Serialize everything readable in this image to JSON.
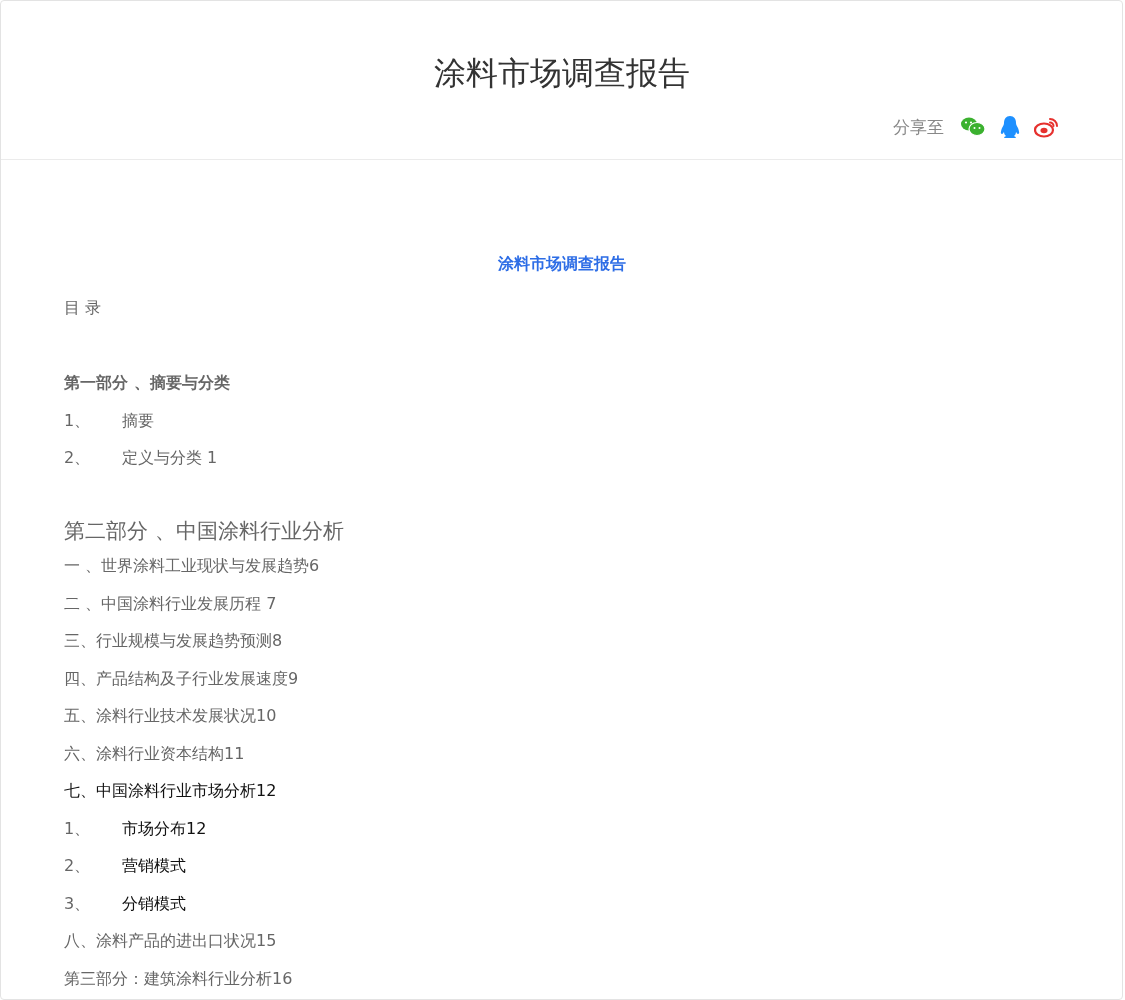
{
  "article": {
    "title": "涂料市场调查报告",
    "share": {
      "label": "分享至"
    }
  },
  "document": {
    "title": "涂料市场调查报告",
    "toc_heading": "目 录",
    "lines": [
      {
        "kind": "part",
        "text": "第一部分 、摘要与分类",
        "dark": false
      },
      {
        "kind": "numbered",
        "number": "1、",
        "text": "摘要",
        "dark": false
      },
      {
        "kind": "numbered",
        "number": "2、",
        "text": "定义与分类 1",
        "dark": false
      },
      {
        "kind": "major",
        "text": "第二部分 、中国涂料行业分析",
        "dark": false
      },
      {
        "kind": "plain",
        "text": "一 、世界涂料工业现状与发展趋势6",
        "dark": false
      },
      {
        "kind": "plain",
        "text": "二 、中国涂料行业发展历程 7",
        "dark": false
      },
      {
        "kind": "plain",
        "text": "三、行业规模与发展趋势预测8",
        "dark": false
      },
      {
        "kind": "plain",
        "text": "四、产品结构及子行业发展速度9",
        "dark": false
      },
      {
        "kind": "plain",
        "text": "五、涂料行业技术发展状况10",
        "dark": false
      },
      {
        "kind": "plain",
        "text": "六、涂料行业资本结构11",
        "dark": false
      },
      {
        "kind": "plain",
        "text": "七、中国涂料行业市场分析12",
        "dark": true
      },
      {
        "kind": "numbered",
        "number": "1、",
        "text": "市场分布12",
        "dark": true
      },
      {
        "kind": "numbered",
        "number": "2、",
        "text": "营销模式",
        "dark": true
      },
      {
        "kind": "numbered",
        "number": "3、",
        "text": "分销模式",
        "dark": true
      },
      {
        "kind": "plain",
        "text": "八、涂料产品的进出口状况15",
        "dark": false
      },
      {
        "kind": "plain",
        "text": "第三部分：建筑涂料行业分析16",
        "dark": false
      }
    ]
  }
}
